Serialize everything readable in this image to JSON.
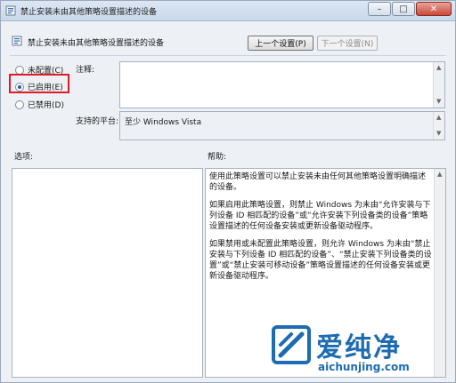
{
  "window": {
    "title": "禁止安装未由其他策略设置描述的设备",
    "minimize_glyph": "–",
    "maximize_glyph": "□",
    "close_glyph": "✕"
  },
  "header": {
    "policy_title": "禁止安装未由其他策略设置描述的设备",
    "prev_button": "上一个设置(P)",
    "next_button": "下一个设置(N)"
  },
  "state": {
    "options": [
      {
        "label": "未配置(C)",
        "checked": false
      },
      {
        "label": "已启用(E)",
        "checked": true
      },
      {
        "label": "已禁用(D)",
        "checked": false
      }
    ],
    "highlight_color": "#e01b24"
  },
  "comment": {
    "label": "注释:",
    "value": ""
  },
  "supported": {
    "label": "支持的平台:",
    "value": "至少 Windows Vista"
  },
  "options_pane": {
    "label": "选项:"
  },
  "help_pane": {
    "label": "帮助:",
    "paragraphs": [
      "使用此策略设置可以禁止安装未由任何其他策略设置明确描述的设备。",
      "如果启用此策略设置，则禁止 Windows 为未由“允许安装与下列设备 ID 相匹配的设备”或“允许安装下列设备类的设备”策略设置描述的任何设备安装或更新设备驱动程序。",
      "如果禁用或未配置此策略设置，则允许 Windows 为未由“禁止安装与下列设备 ID 相匹配的设备”、“禁止安装下列设备类的设置”或“禁止安装可移动设备”策略设置描述的任何设备安装或更新设备驱动程序。"
    ]
  },
  "watermark": {
    "brand": "爱纯净",
    "url": "aichunjing.com",
    "color": "#1d6bb0"
  }
}
